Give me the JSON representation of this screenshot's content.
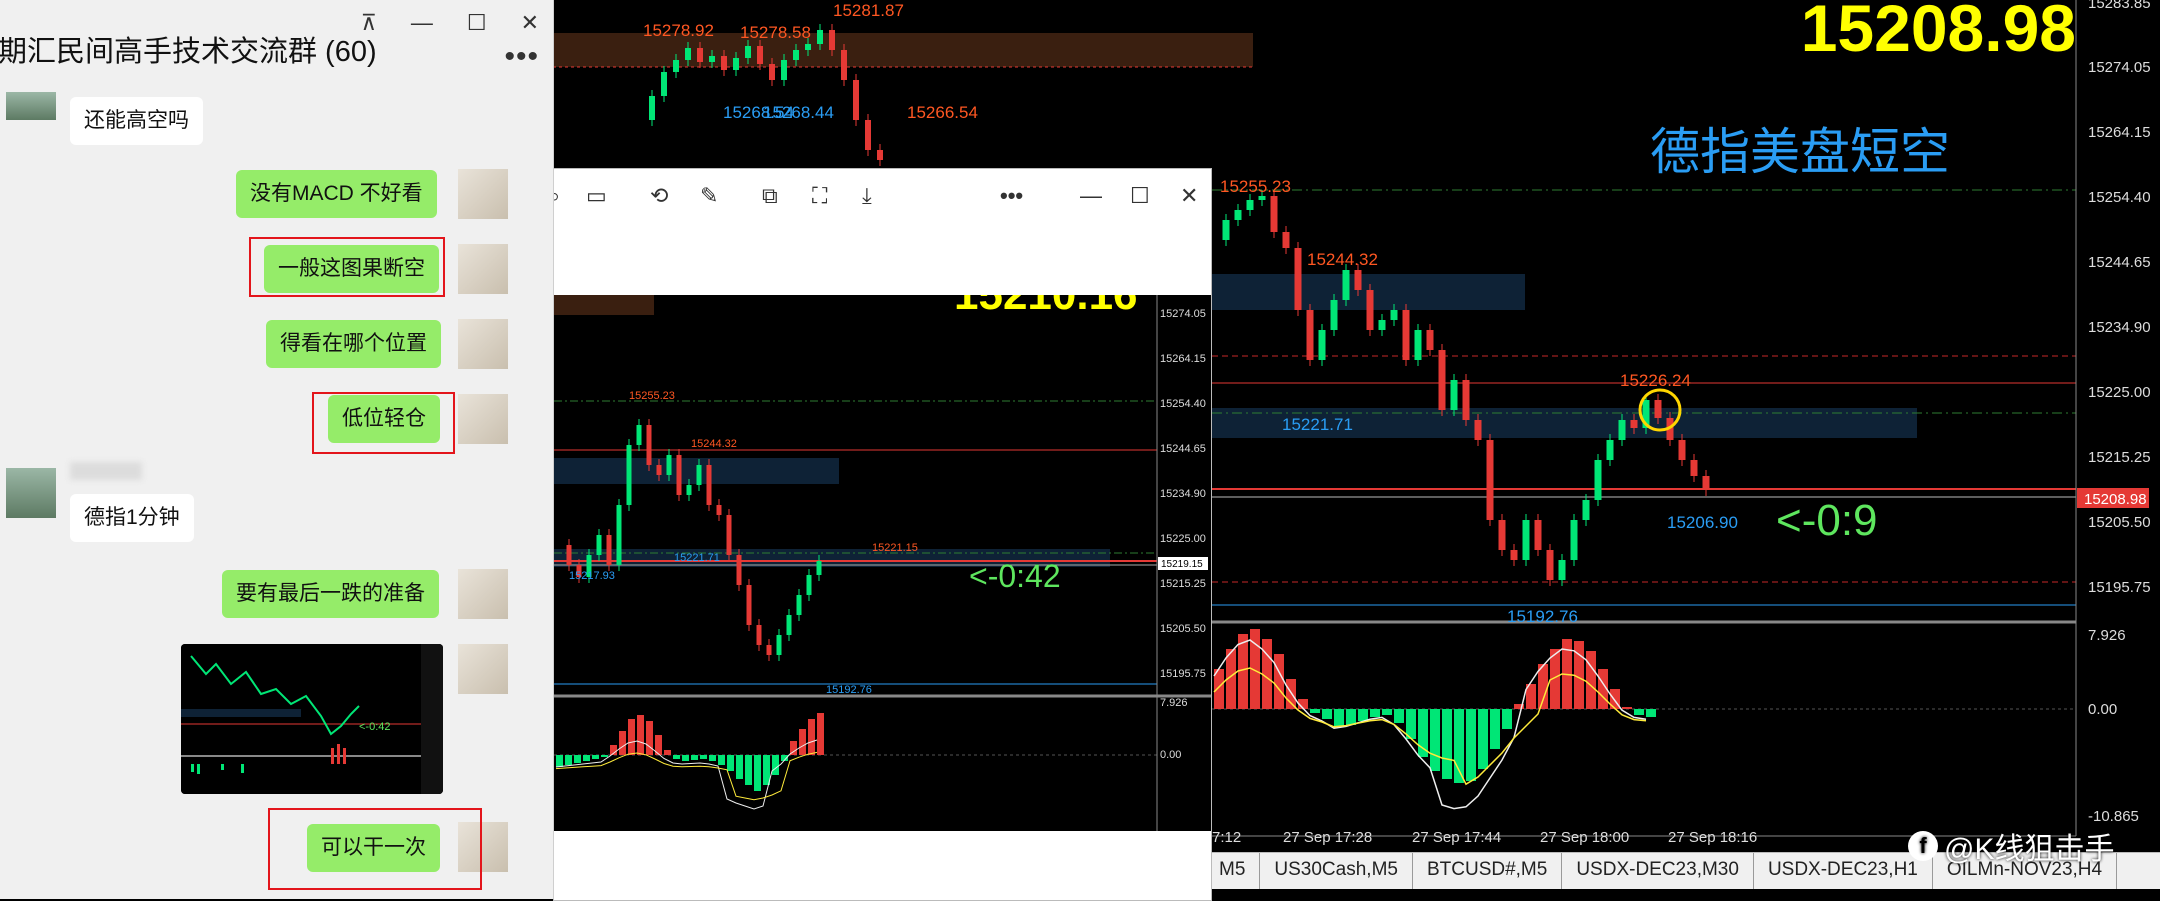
{
  "background_chart": {
    "big_price": "15208.98",
    "caption": "德指美盘短空",
    "countdown": "<-0:9",
    "price_axis": [
      "15283.85",
      "15274.05",
      "15264.15",
      "15254.40",
      "15244.65",
      "15234.90",
      "15225.00",
      "15215.25",
      "15205.50",
      "15195.75"
    ],
    "current_price_tag": "15208.98",
    "indicator_axis": [
      "7.926",
      "0.00",
      "-10.865"
    ],
    "labels": {
      "h1": "15278.92",
      "h2": "15278.58",
      "h3": "15281.87",
      "h4": "15268.54",
      "h5": "15268.44",
      "h6": "15266.54",
      "h7": "15255.23",
      "h8": "15244.32",
      "h9": "15226.24",
      "l1": "15221.71",
      "l2": "15206.90",
      "l3": "15192.76"
    },
    "time_axis": [
      "7:12",
      "27 Sep 17:28",
      "27 Sep 17:44",
      "27 Sep 18:00",
      "27 Sep 18:16"
    ],
    "symbol_tabs": [
      "M5",
      "US30Cash,M5",
      "BTCUSD#,M5",
      "USDX-DEC23,M30",
      "USDX-DEC23,H1",
      "OILMn-NOV23,H4"
    ],
    "watermark": "@K线狙击手"
  },
  "chat": {
    "title": "期汇民间高手技术交流群 (60)",
    "window_buttons": {
      "pin": "⊼",
      "minimize": "—",
      "maximize": "☐",
      "close": "✕"
    },
    "more": "•••",
    "messages": [
      {
        "side": "left",
        "text": "还能高空吗"
      },
      {
        "side": "right",
        "text": "没有MACD 不好看"
      },
      {
        "side": "right",
        "text": "一般这图果断空"
      },
      {
        "side": "right",
        "text": "得看在哪个位置"
      },
      {
        "side": "right",
        "text": "低位轻仓"
      },
      {
        "side": "left",
        "text": "德指1分钟"
      },
      {
        "side": "right",
        "text": "要有最后一跌的准备"
      },
      {
        "side": "right",
        "text": "可以干一次"
      }
    ],
    "thumb_countdown": "<-0:42"
  },
  "popup": {
    "big_price": "15210.16",
    "countdown": "<-0:42",
    "price_axis": [
      "15274.05",
      "15264.15",
      "15254.40",
      "15244.65",
      "15234.90",
      "15225.00",
      "15215.25",
      "15205.50",
      "15195.75"
    ],
    "price_tag": "15219.15",
    "indicator_axis": [
      "7.926",
      "0.00"
    ],
    "labels": {
      "a": "15255.23",
      "b": "15244.32",
      "c": "15221.71",
      "d": "15217.93",
      "e": "15221.15",
      "f": "15192.76"
    }
  },
  "colors": {
    "bull": "#00e676",
    "bear": "#e53935",
    "accent_blue": "#2a9df4",
    "yellow": "#ffff00",
    "wechat_green": "#95ec69"
  }
}
